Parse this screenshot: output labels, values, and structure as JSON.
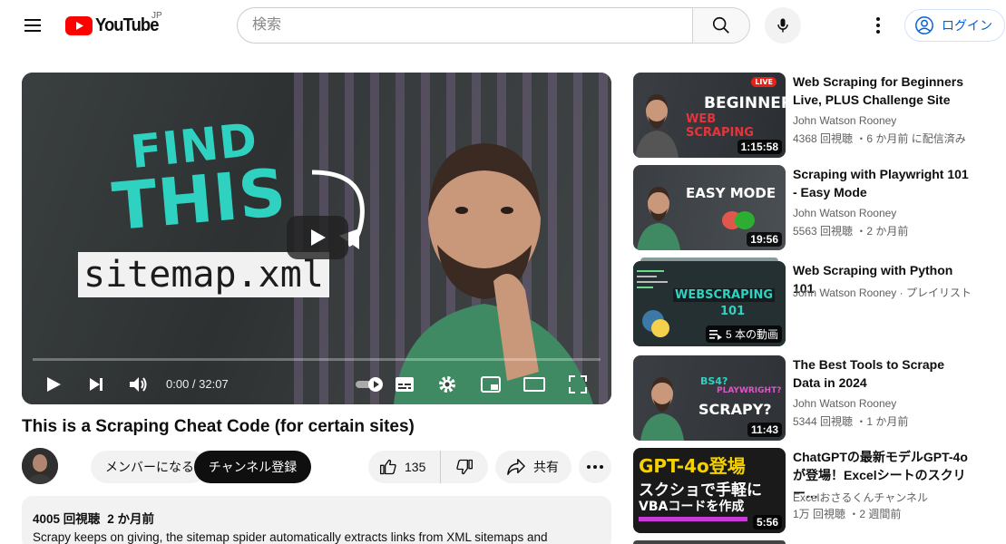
{
  "header": {
    "logo_text": "YouTube",
    "region": "JP",
    "search_placeholder": "検索",
    "login_label": "ログイン"
  },
  "player": {
    "thumb_find": "FIND",
    "thumb_this": "THIS",
    "thumb_code": "sitemap.xml",
    "time": "0:00 / 32:07",
    "progress": 0
  },
  "video": {
    "title": "This is a Scraping Cheat Code (for certain sites)",
    "member_label": "メンバーになる",
    "subscribe_label": "チャンネル登録",
    "likes": "135",
    "share_label": "共有",
    "views": "4005 回視聴",
    "date": "2 か月前",
    "description": "Scrapy keeps on giving, the sitemap spider automatically extracts links from XML sitemaps and"
  },
  "recommendations": [
    {
      "title": "Web Scraping for Beginners Live, PLUS Challenge Site",
      "channel": "John Watson Rooney",
      "meta": "4368 回視聴 ・6 か月前 に配信済み",
      "duration": "1:15:58",
      "thumb_text_1": "BEGINNER",
      "thumb_text_2": "WEB SCRAPING",
      "thumb_badge": "LIVE"
    },
    {
      "title": "Scraping with Playwright 101 - Easy Mode",
      "channel": "John Watson Rooney",
      "meta": "5563 回視聴 ・2 か月前",
      "duration": "19:56",
      "thumb_text_1": "EASY MODE"
    },
    {
      "title": "Web Scraping with Python 101",
      "channel": "John Watson Rooney · プレイリスト",
      "meta": "",
      "duration": "5 本の動画",
      "thumb_text_1": "WEBSCRAPING",
      "thumb_text_2": "101"
    },
    {
      "title": "The Best Tools to Scrape Data in 2024",
      "channel": "John Watson Rooney",
      "meta": "5344 回視聴 ・1 か月前",
      "duration": "11:43",
      "thumb_text_1": "BS4?",
      "thumb_text_2": "PLAYWRIGHT?",
      "thumb_text_3": "SCRAPY?"
    },
    {
      "title": "ChatGPTの最新モデルGPT-4oが登場！Excelシートのスクリー…",
      "channel": "Excelおさるくんチャンネル",
      "meta": "1万 回視聴 ・2 週間前",
      "duration": "5:56",
      "thumb_text_1": "GPT-4o登場",
      "thumb_text_2": "スクショで手軽に",
      "thumb_text_3": "VBAコードを作成"
    }
  ],
  "colors": {
    "brand_red": "#ff0000",
    "link_blue": "#065fd4",
    "teal": "#2fd1c0"
  }
}
